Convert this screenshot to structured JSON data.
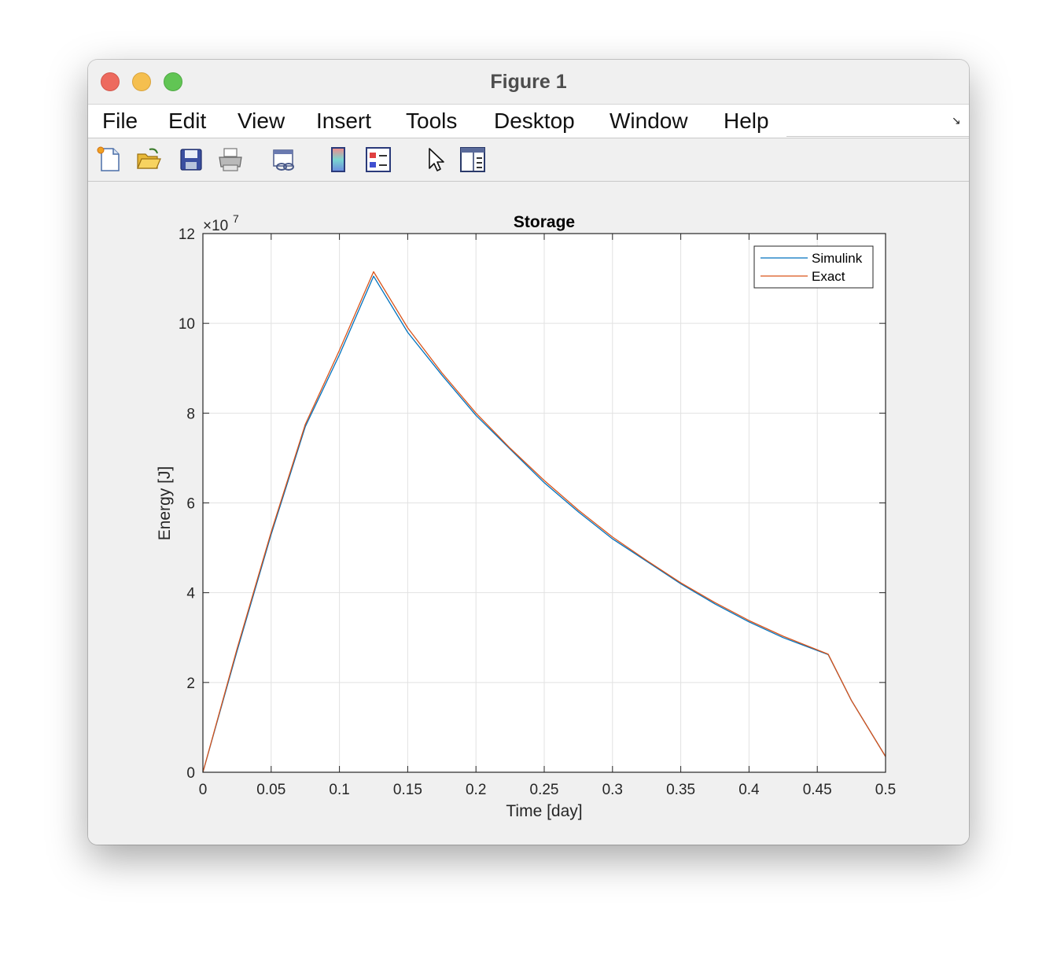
{
  "window": {
    "title": "Figure 1"
  },
  "menu": [
    "File",
    "Edit",
    "View",
    "Insert",
    "Tools",
    "Desktop",
    "Window",
    "Help"
  ],
  "toolbar": {
    "icons": [
      "new-figure-icon",
      "open-file-icon",
      "save-icon",
      "print-icon",
      "link-plot-icon",
      "colorbar-icon",
      "legend-icon",
      "edit-plot-pointer-icon",
      "property-inspector-icon"
    ]
  },
  "chart_data": {
    "type": "line",
    "title": "Storage",
    "xlabel": "Time [day]",
    "ylabel": "Energy [J]",
    "exponent_label": "×10",
    "exponent": "7",
    "xlim": [
      0,
      0.5
    ],
    "ylim": [
      0,
      12
    ],
    "xticks": [
      "0",
      "0.05",
      "0.1",
      "0.15",
      "0.2",
      "0.25",
      "0.3",
      "0.35",
      "0.4",
      "0.45",
      "0.5"
    ],
    "yticks": [
      "0",
      "2",
      "4",
      "6",
      "8",
      "10",
      "12"
    ],
    "grid": true,
    "legend_position": "top-right",
    "series": [
      {
        "name": "Simulink",
        "color": "#0072bd",
        "x": [
          0,
          0.025,
          0.05,
          0.075,
          0.1,
          0.125,
          0.15,
          0.175,
          0.2,
          0.225,
          0.25,
          0.275,
          0.3,
          0.325,
          0.35,
          0.375,
          0.4,
          0.425,
          0.458,
          0.475,
          0.5
        ],
        "y": [
          0,
          2.7,
          5.3,
          7.7,
          9.3,
          11.05,
          9.8,
          8.85,
          7.95,
          7.2,
          6.45,
          5.8,
          5.2,
          4.7,
          4.2,
          3.75,
          3.35,
          3.0,
          2.62,
          1.6,
          0.35
        ]
      },
      {
        "name": "Exact",
        "color": "#d95319",
        "x": [
          0,
          0.025,
          0.05,
          0.075,
          0.1,
          0.125,
          0.15,
          0.175,
          0.2,
          0.225,
          0.25,
          0.275,
          0.3,
          0.325,
          0.35,
          0.375,
          0.4,
          0.425,
          0.458,
          0.475,
          0.5
        ],
        "y": [
          0,
          2.75,
          5.35,
          7.75,
          9.4,
          11.15,
          9.9,
          8.9,
          8.0,
          7.22,
          6.5,
          5.84,
          5.24,
          4.72,
          4.22,
          3.78,
          3.38,
          3.03,
          2.63,
          1.6,
          0.35
        ]
      }
    ]
  }
}
